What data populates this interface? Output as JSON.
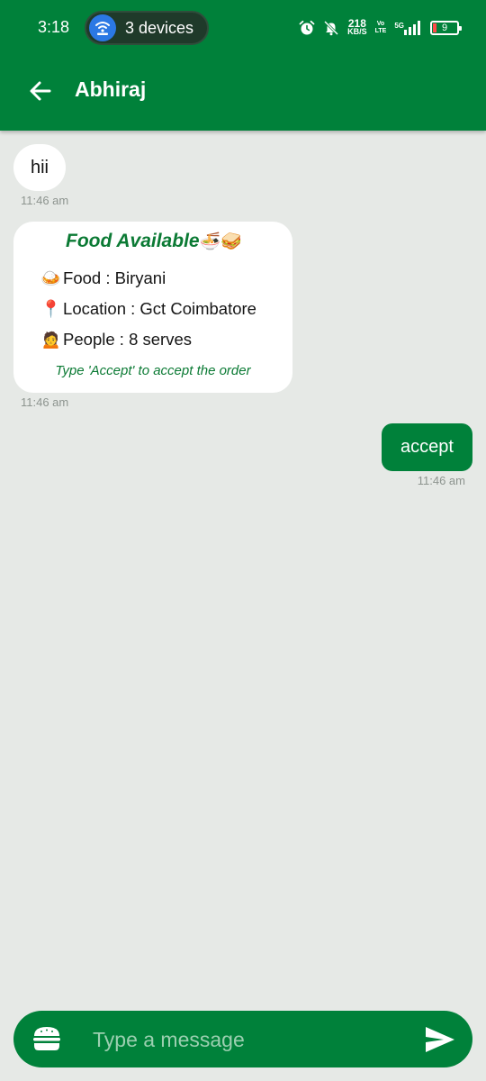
{
  "status_bar": {
    "time": "3:18",
    "hotspot_label": "3 devices",
    "speed_value": "218",
    "speed_unit": "KB/S",
    "volte_top": "Vo",
    "volte_bottom": "LTE",
    "network_type": "5G",
    "battery_level": "9",
    "icons": [
      "alarm-icon",
      "bell-off-icon",
      "signal-icon",
      "battery-icon"
    ]
  },
  "header": {
    "title": "Abhiraj",
    "back_icon": "arrow-left-icon"
  },
  "messages": [
    {
      "direction": "incoming",
      "text": "hii",
      "time": "11:46 am"
    },
    {
      "direction": "incoming",
      "type": "card",
      "title": "Food Available",
      "title_emoji": "🍜🥪",
      "rows": [
        {
          "emoji": "🍛",
          "text": "Food : Biryani"
        },
        {
          "emoji": "📍",
          "text": "Location : Gct Coimbatore"
        },
        {
          "emoji": "🙍",
          "text": "People : 8 serves"
        }
      ],
      "hint": "Type 'Accept' to accept the order",
      "time": "11:46 am"
    },
    {
      "direction": "outgoing",
      "text": "accept",
      "time": "11:46 am"
    }
  ],
  "composer": {
    "placeholder": "Type a message",
    "value": "",
    "left_icon": "burger-icon",
    "send_icon": "send-icon"
  },
  "colors": {
    "primary": "#00813a",
    "background": "#e6e9e6",
    "accent_text": "#0b7a34",
    "hotspot": "#2b78e4"
  }
}
